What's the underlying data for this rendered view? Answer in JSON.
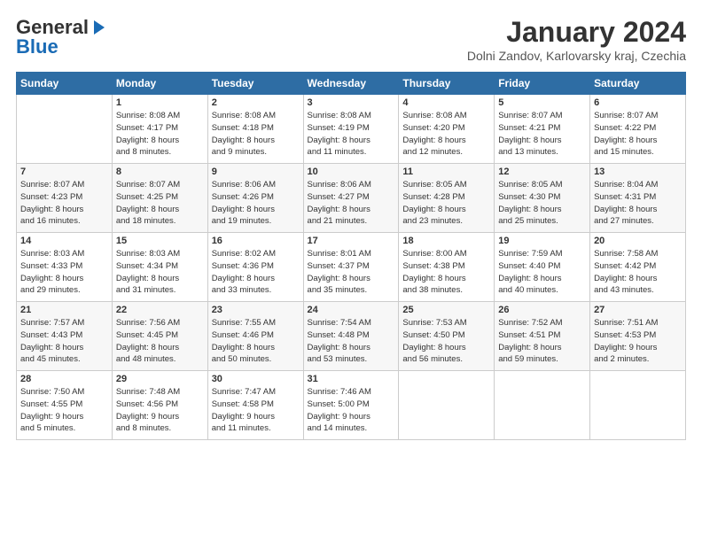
{
  "header": {
    "logo_general": "General",
    "logo_blue": "Blue",
    "month": "January 2024",
    "location": "Dolni Zandov, Karlovarsky kraj, Czechia"
  },
  "days_of_week": [
    "Sunday",
    "Monday",
    "Tuesday",
    "Wednesday",
    "Thursday",
    "Friday",
    "Saturday"
  ],
  "weeks": [
    [
      {
        "day": "",
        "info": ""
      },
      {
        "day": "1",
        "info": "Sunrise: 8:08 AM\nSunset: 4:17 PM\nDaylight: 8 hours\nand 8 minutes."
      },
      {
        "day": "2",
        "info": "Sunrise: 8:08 AM\nSunset: 4:18 PM\nDaylight: 8 hours\nand 9 minutes."
      },
      {
        "day": "3",
        "info": "Sunrise: 8:08 AM\nSunset: 4:19 PM\nDaylight: 8 hours\nand 11 minutes."
      },
      {
        "day": "4",
        "info": "Sunrise: 8:08 AM\nSunset: 4:20 PM\nDaylight: 8 hours\nand 12 minutes."
      },
      {
        "day": "5",
        "info": "Sunrise: 8:07 AM\nSunset: 4:21 PM\nDaylight: 8 hours\nand 13 minutes."
      },
      {
        "day": "6",
        "info": "Sunrise: 8:07 AM\nSunset: 4:22 PM\nDaylight: 8 hours\nand 15 minutes."
      }
    ],
    [
      {
        "day": "7",
        "info": "Sunrise: 8:07 AM\nSunset: 4:23 PM\nDaylight: 8 hours\nand 16 minutes."
      },
      {
        "day": "8",
        "info": "Sunrise: 8:07 AM\nSunset: 4:25 PM\nDaylight: 8 hours\nand 18 minutes."
      },
      {
        "day": "9",
        "info": "Sunrise: 8:06 AM\nSunset: 4:26 PM\nDaylight: 8 hours\nand 19 minutes."
      },
      {
        "day": "10",
        "info": "Sunrise: 8:06 AM\nSunset: 4:27 PM\nDaylight: 8 hours\nand 21 minutes."
      },
      {
        "day": "11",
        "info": "Sunrise: 8:05 AM\nSunset: 4:28 PM\nDaylight: 8 hours\nand 23 minutes."
      },
      {
        "day": "12",
        "info": "Sunrise: 8:05 AM\nSunset: 4:30 PM\nDaylight: 8 hours\nand 25 minutes."
      },
      {
        "day": "13",
        "info": "Sunrise: 8:04 AM\nSunset: 4:31 PM\nDaylight: 8 hours\nand 27 minutes."
      }
    ],
    [
      {
        "day": "14",
        "info": "Sunrise: 8:03 AM\nSunset: 4:33 PM\nDaylight: 8 hours\nand 29 minutes."
      },
      {
        "day": "15",
        "info": "Sunrise: 8:03 AM\nSunset: 4:34 PM\nDaylight: 8 hours\nand 31 minutes."
      },
      {
        "day": "16",
        "info": "Sunrise: 8:02 AM\nSunset: 4:36 PM\nDaylight: 8 hours\nand 33 minutes."
      },
      {
        "day": "17",
        "info": "Sunrise: 8:01 AM\nSunset: 4:37 PM\nDaylight: 8 hours\nand 35 minutes."
      },
      {
        "day": "18",
        "info": "Sunrise: 8:00 AM\nSunset: 4:38 PM\nDaylight: 8 hours\nand 38 minutes."
      },
      {
        "day": "19",
        "info": "Sunrise: 7:59 AM\nSunset: 4:40 PM\nDaylight: 8 hours\nand 40 minutes."
      },
      {
        "day": "20",
        "info": "Sunrise: 7:58 AM\nSunset: 4:42 PM\nDaylight: 8 hours\nand 43 minutes."
      }
    ],
    [
      {
        "day": "21",
        "info": "Sunrise: 7:57 AM\nSunset: 4:43 PM\nDaylight: 8 hours\nand 45 minutes."
      },
      {
        "day": "22",
        "info": "Sunrise: 7:56 AM\nSunset: 4:45 PM\nDaylight: 8 hours\nand 48 minutes."
      },
      {
        "day": "23",
        "info": "Sunrise: 7:55 AM\nSunset: 4:46 PM\nDaylight: 8 hours\nand 50 minutes."
      },
      {
        "day": "24",
        "info": "Sunrise: 7:54 AM\nSunset: 4:48 PM\nDaylight: 8 hours\nand 53 minutes."
      },
      {
        "day": "25",
        "info": "Sunrise: 7:53 AM\nSunset: 4:50 PM\nDaylight: 8 hours\nand 56 minutes."
      },
      {
        "day": "26",
        "info": "Sunrise: 7:52 AM\nSunset: 4:51 PM\nDaylight: 8 hours\nand 59 minutes."
      },
      {
        "day": "27",
        "info": "Sunrise: 7:51 AM\nSunset: 4:53 PM\nDaylight: 9 hours\nand 2 minutes."
      }
    ],
    [
      {
        "day": "28",
        "info": "Sunrise: 7:50 AM\nSunset: 4:55 PM\nDaylight: 9 hours\nand 5 minutes."
      },
      {
        "day": "29",
        "info": "Sunrise: 7:48 AM\nSunset: 4:56 PM\nDaylight: 9 hours\nand 8 minutes."
      },
      {
        "day": "30",
        "info": "Sunrise: 7:47 AM\nSunset: 4:58 PM\nDaylight: 9 hours\nand 11 minutes."
      },
      {
        "day": "31",
        "info": "Sunrise: 7:46 AM\nSunset: 5:00 PM\nDaylight: 9 hours\nand 14 minutes."
      },
      {
        "day": "",
        "info": ""
      },
      {
        "day": "",
        "info": ""
      },
      {
        "day": "",
        "info": ""
      }
    ]
  ]
}
